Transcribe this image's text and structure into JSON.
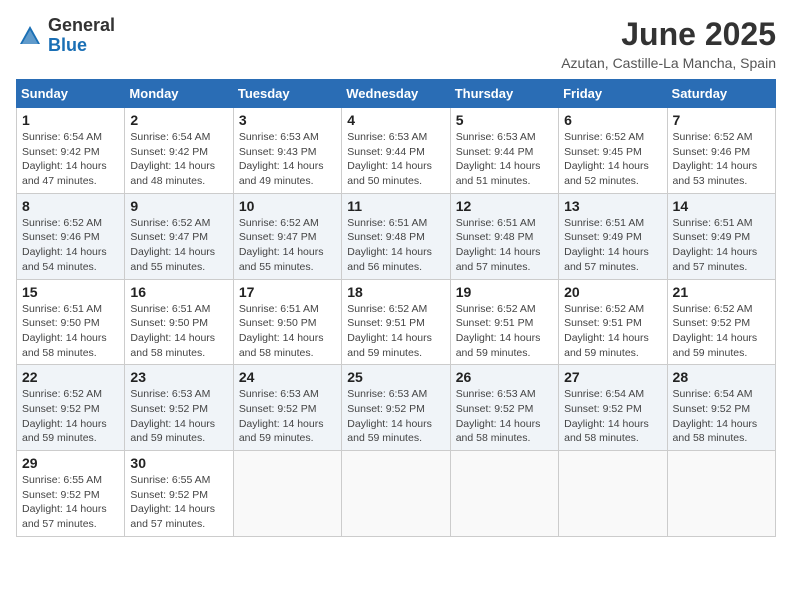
{
  "logo": {
    "general": "General",
    "blue": "Blue"
  },
  "header": {
    "title": "June 2025",
    "subtitle": "Azutan, Castille-La Mancha, Spain"
  },
  "weekdays": [
    "Sunday",
    "Monday",
    "Tuesday",
    "Wednesday",
    "Thursday",
    "Friday",
    "Saturday"
  ],
  "weeks": [
    [
      {
        "day": "1",
        "sunrise": "Sunrise: 6:54 AM",
        "sunset": "Sunset: 9:42 PM",
        "daylight": "Daylight: 14 hours and 47 minutes."
      },
      {
        "day": "2",
        "sunrise": "Sunrise: 6:54 AM",
        "sunset": "Sunset: 9:42 PM",
        "daylight": "Daylight: 14 hours and 48 minutes."
      },
      {
        "day": "3",
        "sunrise": "Sunrise: 6:53 AM",
        "sunset": "Sunset: 9:43 PM",
        "daylight": "Daylight: 14 hours and 49 minutes."
      },
      {
        "day": "4",
        "sunrise": "Sunrise: 6:53 AM",
        "sunset": "Sunset: 9:44 PM",
        "daylight": "Daylight: 14 hours and 50 minutes."
      },
      {
        "day": "5",
        "sunrise": "Sunrise: 6:53 AM",
        "sunset": "Sunset: 9:44 PM",
        "daylight": "Daylight: 14 hours and 51 minutes."
      },
      {
        "day": "6",
        "sunrise": "Sunrise: 6:52 AM",
        "sunset": "Sunset: 9:45 PM",
        "daylight": "Daylight: 14 hours and 52 minutes."
      },
      {
        "day": "7",
        "sunrise": "Sunrise: 6:52 AM",
        "sunset": "Sunset: 9:46 PM",
        "daylight": "Daylight: 14 hours and 53 minutes."
      }
    ],
    [
      {
        "day": "8",
        "sunrise": "Sunrise: 6:52 AM",
        "sunset": "Sunset: 9:46 PM",
        "daylight": "Daylight: 14 hours and 54 minutes."
      },
      {
        "day": "9",
        "sunrise": "Sunrise: 6:52 AM",
        "sunset": "Sunset: 9:47 PM",
        "daylight": "Daylight: 14 hours and 55 minutes."
      },
      {
        "day": "10",
        "sunrise": "Sunrise: 6:52 AM",
        "sunset": "Sunset: 9:47 PM",
        "daylight": "Daylight: 14 hours and 55 minutes."
      },
      {
        "day": "11",
        "sunrise": "Sunrise: 6:51 AM",
        "sunset": "Sunset: 9:48 PM",
        "daylight": "Daylight: 14 hours and 56 minutes."
      },
      {
        "day": "12",
        "sunrise": "Sunrise: 6:51 AM",
        "sunset": "Sunset: 9:48 PM",
        "daylight": "Daylight: 14 hours and 57 minutes."
      },
      {
        "day": "13",
        "sunrise": "Sunrise: 6:51 AM",
        "sunset": "Sunset: 9:49 PM",
        "daylight": "Daylight: 14 hours and 57 minutes."
      },
      {
        "day": "14",
        "sunrise": "Sunrise: 6:51 AM",
        "sunset": "Sunset: 9:49 PM",
        "daylight": "Daylight: 14 hours and 57 minutes."
      }
    ],
    [
      {
        "day": "15",
        "sunrise": "Sunrise: 6:51 AM",
        "sunset": "Sunset: 9:50 PM",
        "daylight": "Daylight: 14 hours and 58 minutes."
      },
      {
        "day": "16",
        "sunrise": "Sunrise: 6:51 AM",
        "sunset": "Sunset: 9:50 PM",
        "daylight": "Daylight: 14 hours and 58 minutes."
      },
      {
        "day": "17",
        "sunrise": "Sunrise: 6:51 AM",
        "sunset": "Sunset: 9:50 PM",
        "daylight": "Daylight: 14 hours and 58 minutes."
      },
      {
        "day": "18",
        "sunrise": "Sunrise: 6:52 AM",
        "sunset": "Sunset: 9:51 PM",
        "daylight": "Daylight: 14 hours and 59 minutes."
      },
      {
        "day": "19",
        "sunrise": "Sunrise: 6:52 AM",
        "sunset": "Sunset: 9:51 PM",
        "daylight": "Daylight: 14 hours and 59 minutes."
      },
      {
        "day": "20",
        "sunrise": "Sunrise: 6:52 AM",
        "sunset": "Sunset: 9:51 PM",
        "daylight": "Daylight: 14 hours and 59 minutes."
      },
      {
        "day": "21",
        "sunrise": "Sunrise: 6:52 AM",
        "sunset": "Sunset: 9:52 PM",
        "daylight": "Daylight: 14 hours and 59 minutes."
      }
    ],
    [
      {
        "day": "22",
        "sunrise": "Sunrise: 6:52 AM",
        "sunset": "Sunset: 9:52 PM",
        "daylight": "Daylight: 14 hours and 59 minutes."
      },
      {
        "day": "23",
        "sunrise": "Sunrise: 6:53 AM",
        "sunset": "Sunset: 9:52 PM",
        "daylight": "Daylight: 14 hours and 59 minutes."
      },
      {
        "day": "24",
        "sunrise": "Sunrise: 6:53 AM",
        "sunset": "Sunset: 9:52 PM",
        "daylight": "Daylight: 14 hours and 59 minutes."
      },
      {
        "day": "25",
        "sunrise": "Sunrise: 6:53 AM",
        "sunset": "Sunset: 9:52 PM",
        "daylight": "Daylight: 14 hours and 59 minutes."
      },
      {
        "day": "26",
        "sunrise": "Sunrise: 6:53 AM",
        "sunset": "Sunset: 9:52 PM",
        "daylight": "Daylight: 14 hours and 58 minutes."
      },
      {
        "day": "27",
        "sunrise": "Sunrise: 6:54 AM",
        "sunset": "Sunset: 9:52 PM",
        "daylight": "Daylight: 14 hours and 58 minutes."
      },
      {
        "day": "28",
        "sunrise": "Sunrise: 6:54 AM",
        "sunset": "Sunset: 9:52 PM",
        "daylight": "Daylight: 14 hours and 58 minutes."
      }
    ],
    [
      {
        "day": "29",
        "sunrise": "Sunrise: 6:55 AM",
        "sunset": "Sunset: 9:52 PM",
        "daylight": "Daylight: 14 hours and 57 minutes."
      },
      {
        "day": "30",
        "sunrise": "Sunrise: 6:55 AM",
        "sunset": "Sunset: 9:52 PM",
        "daylight": "Daylight: 14 hours and 57 minutes."
      },
      null,
      null,
      null,
      null,
      null
    ]
  ]
}
